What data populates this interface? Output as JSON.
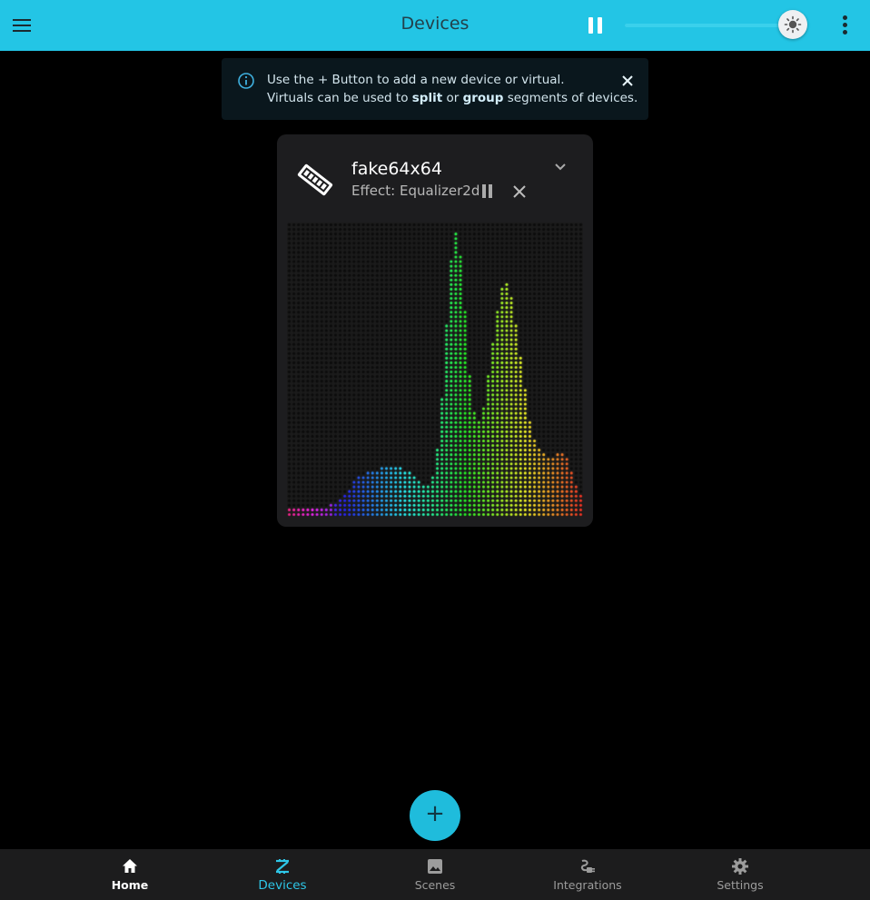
{
  "appbar": {
    "title": "Devices",
    "brightness_level": 0.97,
    "icons": {
      "menu": "menu-icon",
      "pause": "pause-icon",
      "brightness": "sun-icon",
      "more": "more-vert-icon"
    },
    "color": "#23c5e5"
  },
  "alert": {
    "line1": "Use the + Button to add a new device or virtual.",
    "line2_pre": "Virtuals can be used to ",
    "line2_split": "split",
    "line2_mid": " or ",
    "line2_group": "group",
    "line2_post": " segments of devices.",
    "icons": {
      "info": "info-icon",
      "close": "close-icon"
    }
  },
  "device_card": {
    "name": "fake64x64",
    "effect_label": "Effect: Equalizer2d",
    "icons": {
      "device": "led-strip-icon",
      "pause": "pause-icon",
      "clear": "close-icon",
      "expand": "chevron-down-icon"
    }
  },
  "fab": {
    "label": "+"
  },
  "bottom_nav": {
    "items": [
      {
        "label": "Home",
        "icon": "home-icon"
      },
      {
        "label": "Devices",
        "icon": "devices-icon"
      },
      {
        "label": "Scenes",
        "icon": "image-icon"
      },
      {
        "label": "Integrations",
        "icon": "integrations-icon"
      },
      {
        "label": "Settings",
        "icon": "gear-icon"
      }
    ],
    "active": "Devices"
  },
  "colors": {
    "accent": "#23c5e5",
    "card": "#1d1d1f",
    "nav_bg": "#1c1c1d"
  }
}
